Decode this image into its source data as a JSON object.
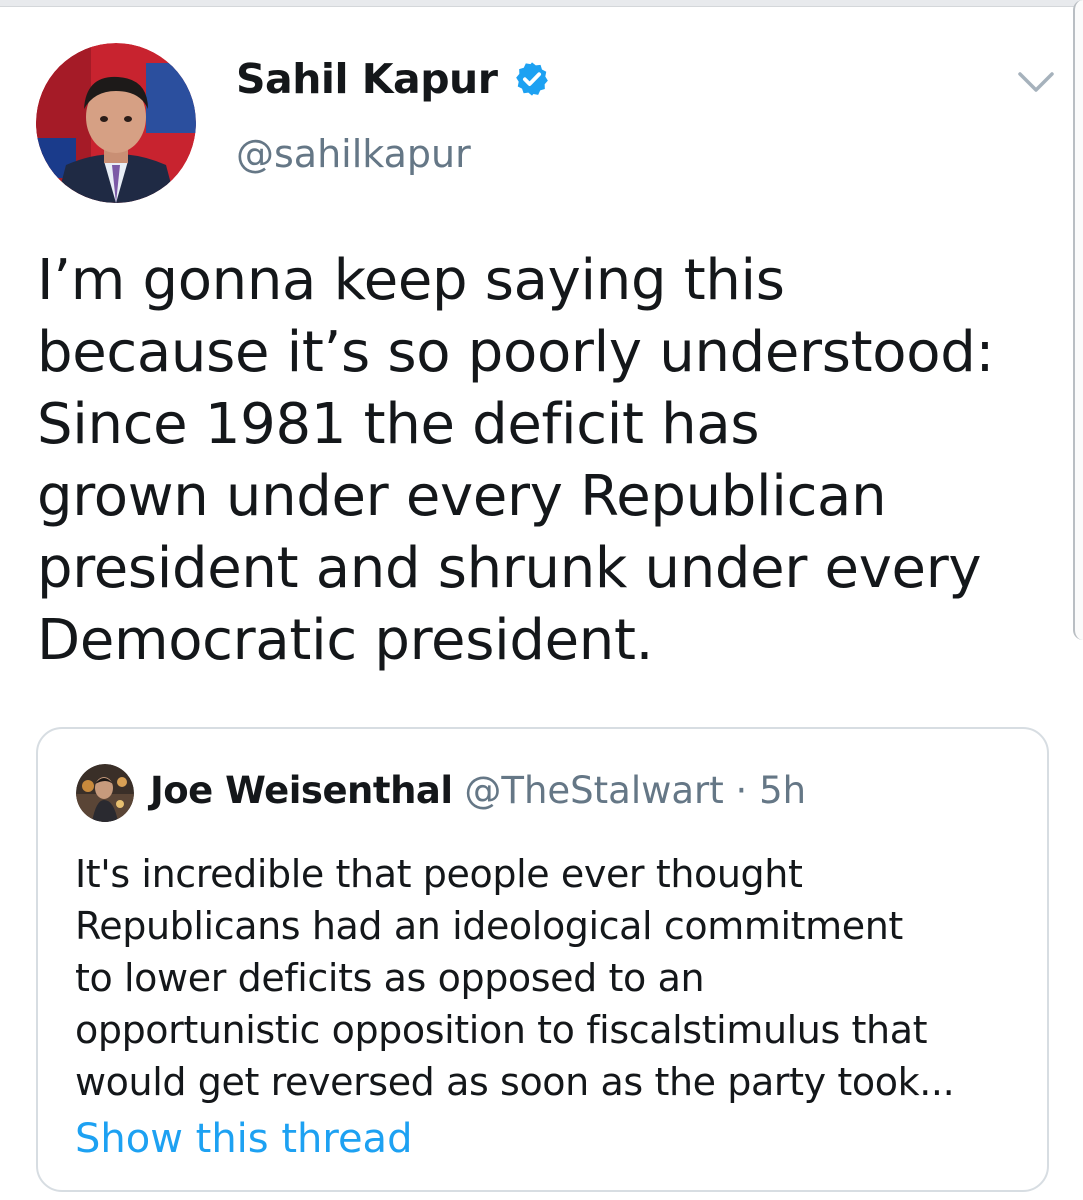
{
  "author": {
    "display_name": "Sahil Kapur",
    "handle": "@sahilkapur",
    "verified": true,
    "avatar": "avatar-photo"
  },
  "tweet": {
    "lines": [
      "I’m gonna keep saying this",
      "because it’s so poorly understood:",
      "Since 1981 the deficit has",
      "grown under every Republican",
      "president and shrunk under every",
      "Democratic president."
    ]
  },
  "quoted": {
    "display_name": "Joe Weisenthal",
    "handle": "@TheStalwart",
    "separator": "·",
    "time": "5h",
    "lines": [
      "It's incredible that people ever thought",
      "Republicans had an ideological commitment",
      "to lower deficits as opposed to an",
      "opportunistic opposition to fiscalstimulus that",
      "would get reversed as soon as the party took..."
    ],
    "show_thread": "Show this thread"
  },
  "colors": {
    "link": "#1da1f2",
    "secondary_text": "#657786",
    "verified_badge": "#1da1f2",
    "border": "#d7dde2"
  },
  "icons": {
    "verified": "verified-badge-icon",
    "menu": "chevron-down-icon"
  }
}
